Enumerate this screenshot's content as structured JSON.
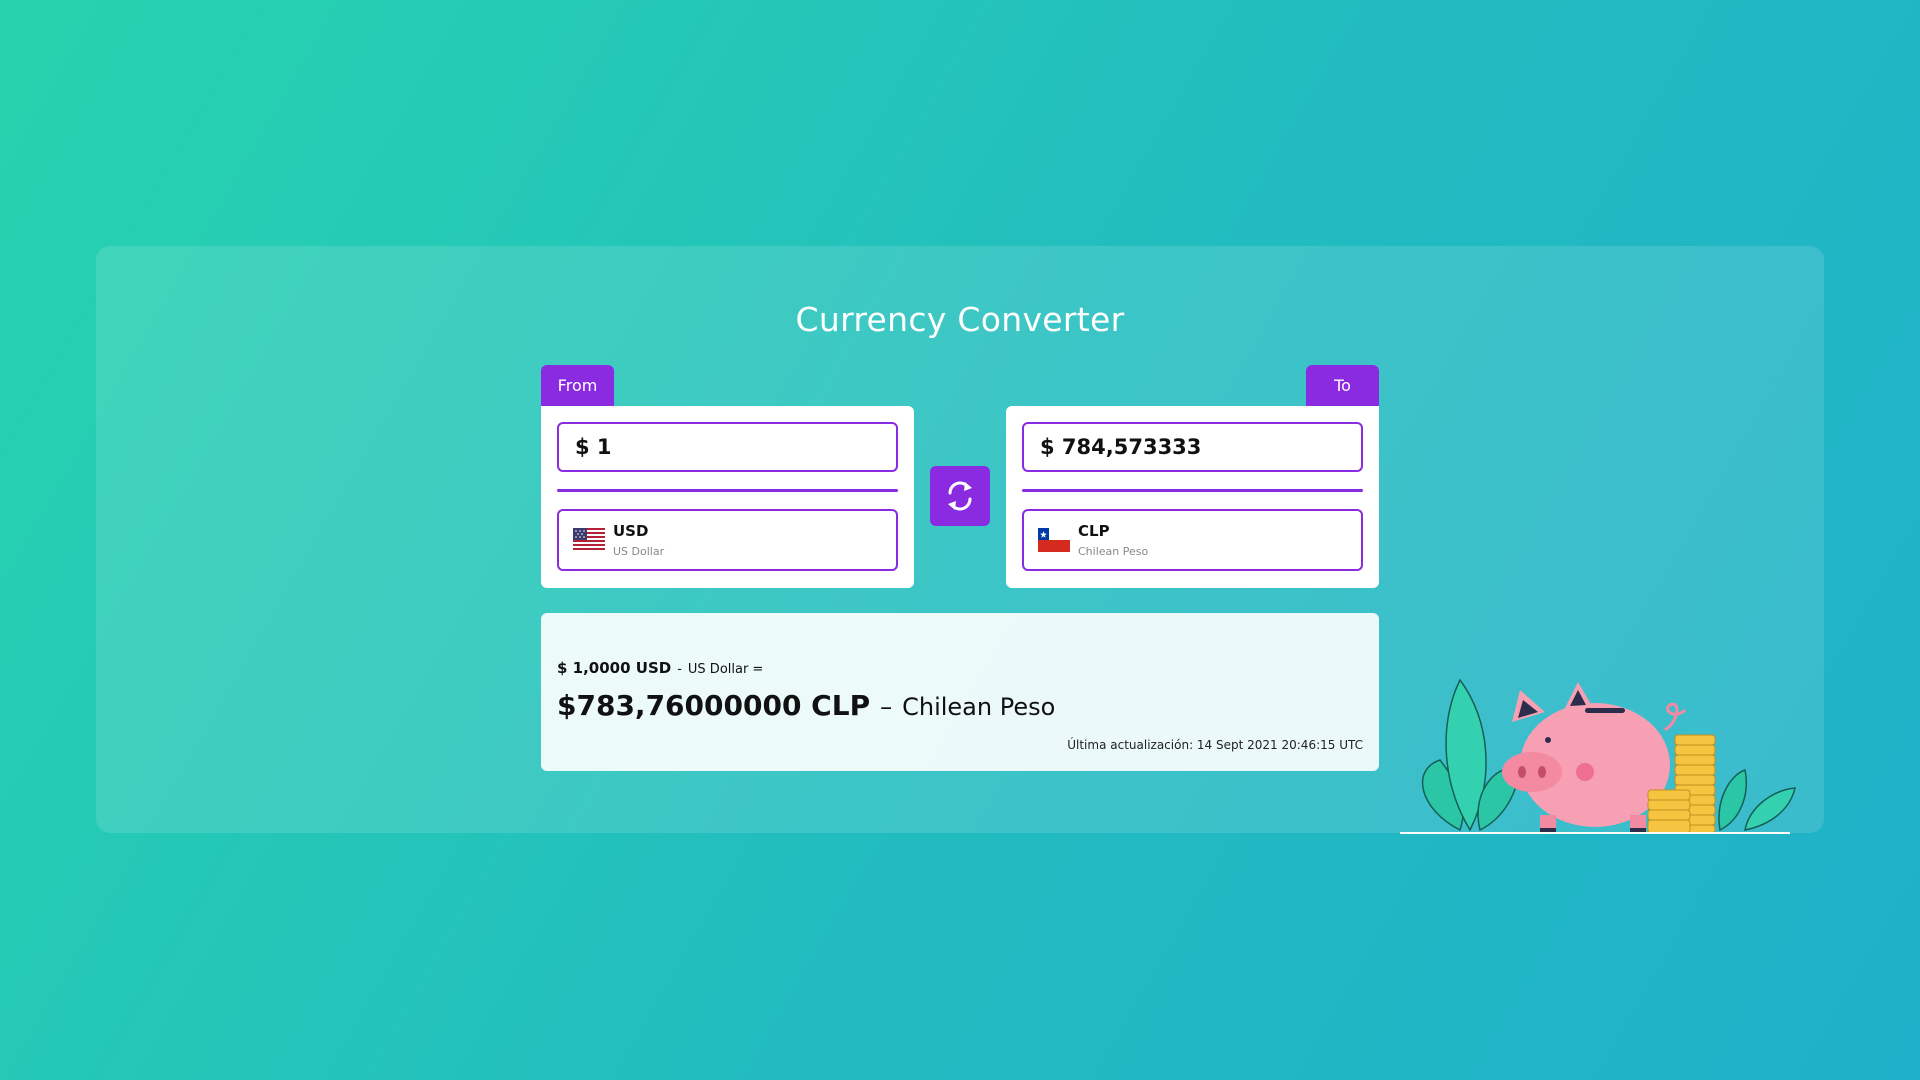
{
  "app": {
    "title": "Currency Converter"
  },
  "from": {
    "tab_label": "From",
    "amount": "$ 1",
    "currency_code": "USD",
    "currency_name": "US Dollar",
    "flag_icon": "us-flag-icon"
  },
  "to": {
    "tab_label": "To",
    "amount": "$ 784,573333",
    "currency_code": "CLP",
    "currency_name": "Chilean Peso",
    "flag_icon": "chile-flag-icon"
  },
  "swap": {
    "icon": "swap-arrows-icon"
  },
  "result": {
    "base_amount": "$ 1,0000 USD",
    "separator": "-",
    "base_name": "US Dollar =",
    "converted_amount": "$783,76000000 CLP",
    "converted_separator": "–",
    "converted_name": "Chilean Peso",
    "last_update": "Última actualización: 14 Sept 2021 20:46:15 UTC"
  },
  "colors": {
    "accent": "#8a2be2",
    "bg_start": "#27d3ae",
    "bg_end": "#1fb0c9"
  }
}
